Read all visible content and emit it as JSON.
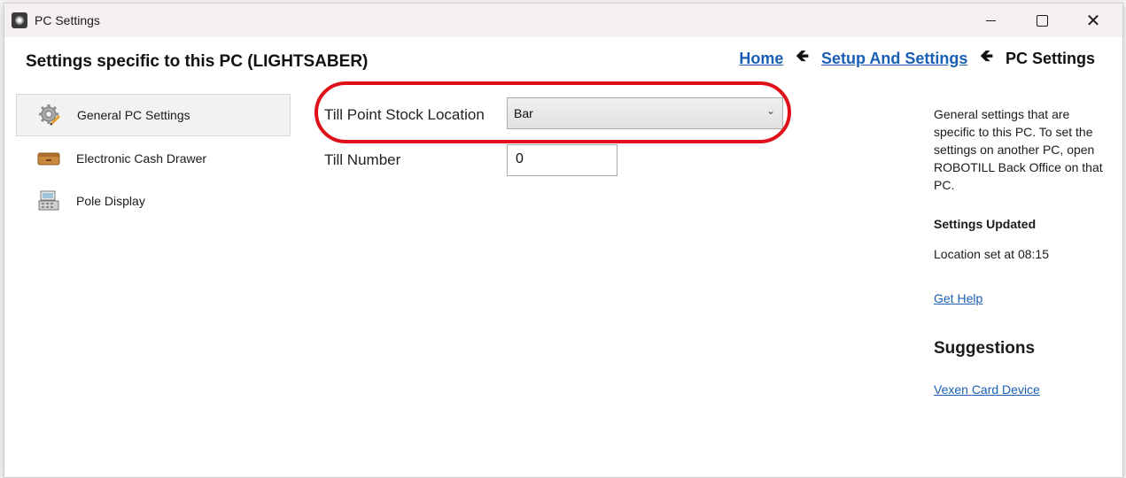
{
  "window": {
    "title": "PC Settings"
  },
  "header": {
    "page_title": "Settings specific to this PC (LIGHTSABER)",
    "breadcrumb": [
      {
        "label": "Home",
        "link": true
      },
      {
        "label": "Setup And Settings",
        "link": true
      },
      {
        "label": "PC Settings",
        "link": false
      }
    ]
  },
  "nav": {
    "items": [
      {
        "label": "General PC Settings",
        "icon": "gear-pencil-icon",
        "selected": true
      },
      {
        "label": "Electronic Cash Drawer",
        "icon": "cash-drawer-icon",
        "selected": false
      },
      {
        "label": "Pole Display",
        "icon": "pole-display-icon",
        "selected": false
      }
    ]
  },
  "form": {
    "stock_location_label": "Till Point Stock Location",
    "stock_location_value": "Bar",
    "till_number_label": "Till Number",
    "till_number_value": "0"
  },
  "sidebar": {
    "description": "General settings that are specific to this PC. To set the settings on another PC, open ROBOTILL Back Office on that PC.",
    "status_heading": "Settings Updated",
    "status_text": "Location set at 08:15",
    "help_link": "Get Help",
    "suggestions_heading": "Suggestions",
    "suggestion_link": "Vexen Card Device"
  },
  "colors": {
    "link": "#1a5fb4",
    "highlight": "#e0101a",
    "titlebar": "#f7f0f2"
  }
}
